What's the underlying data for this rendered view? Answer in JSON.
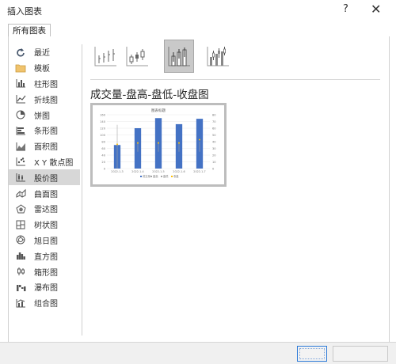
{
  "window": {
    "title": "插入图表",
    "help_label": "?",
    "close_label": "✕"
  },
  "tabs": [
    {
      "label": "所有图表"
    }
  ],
  "sidebar": {
    "items": [
      {
        "label": "最近",
        "icon": "recent-icon"
      },
      {
        "label": "模板",
        "icon": "folder-icon"
      },
      {
        "label": "柱形图",
        "icon": "column-chart-icon"
      },
      {
        "label": "折线图",
        "icon": "line-chart-icon"
      },
      {
        "label": "饼图",
        "icon": "pie-chart-icon"
      },
      {
        "label": "条形图",
        "icon": "bar-chart-icon"
      },
      {
        "label": "面积图",
        "icon": "area-chart-icon"
      },
      {
        "label": "X Y 散点图",
        "icon": "scatter-chart-icon"
      },
      {
        "label": "股价图",
        "icon": "stock-chart-icon"
      },
      {
        "label": "曲面图",
        "icon": "surface-chart-icon"
      },
      {
        "label": "雷达图",
        "icon": "radar-chart-icon"
      },
      {
        "label": "树状图",
        "icon": "treemap-chart-icon"
      },
      {
        "label": "旭日图",
        "icon": "sunburst-chart-icon"
      },
      {
        "label": "直方图",
        "icon": "histogram-chart-icon"
      },
      {
        "label": "箱形图",
        "icon": "box-chart-icon"
      },
      {
        "label": "瀑布图",
        "icon": "waterfall-chart-icon"
      },
      {
        "label": "组合图",
        "icon": "combo-chart-icon"
      }
    ],
    "selected_index": 8
  },
  "subtypes": [
    {
      "icon": "high-low-close-icon"
    },
    {
      "icon": "open-high-low-close-icon"
    },
    {
      "icon": "volume-high-low-close-icon"
    },
    {
      "icon": "volume-open-high-low-close-icon"
    }
  ],
  "selected_subtype_index": 2,
  "selected_chart": {
    "name": "成交量-盘高-盘低-收盘图"
  },
  "preview": {
    "title": "图表标题",
    "left_ticks": [
      "160",
      "140",
      "120",
      "100",
      "80",
      "60",
      "40",
      "20",
      "0"
    ],
    "right_ticks": [
      "80",
      "70",
      "60",
      "50",
      "40",
      "30",
      "20",
      "10",
      "0"
    ],
    "categories": [
      "2022-1-3",
      "2022-1-4",
      "2022-1-5",
      "2022-1-6",
      "2022-1-7"
    ],
    "legend": [
      "成交量",
      "盘高",
      "盘低",
      "收盘"
    ]
  },
  "colors": {
    "bar": "#4472c4",
    "marker": "#ffc000",
    "line": "#a5a5a5"
  },
  "chart_data": {
    "type": "bar",
    "title": "图表标题",
    "categories": [
      "2022-1-3",
      "2022-1-4",
      "2022-1-5",
      "2022-1-6",
      "2022-1-7"
    ],
    "ylim": [
      0,
      160
    ],
    "y2lim": [
      0,
      80
    ],
    "series": [
      {
        "name": "成交量",
        "values": [
          70,
          120,
          150,
          132,
          148
        ]
      },
      {
        "name": "盘高",
        "values": [
          65,
          40,
          40,
          40,
          40
        ]
      },
      {
        "name": "盘低",
        "values": [
          0,
          25,
          25,
          25,
          25
        ]
      },
      {
        "name": "收盘",
        "values": [
          36,
          38,
          38,
          38,
          43
        ]
      }
    ]
  }
}
